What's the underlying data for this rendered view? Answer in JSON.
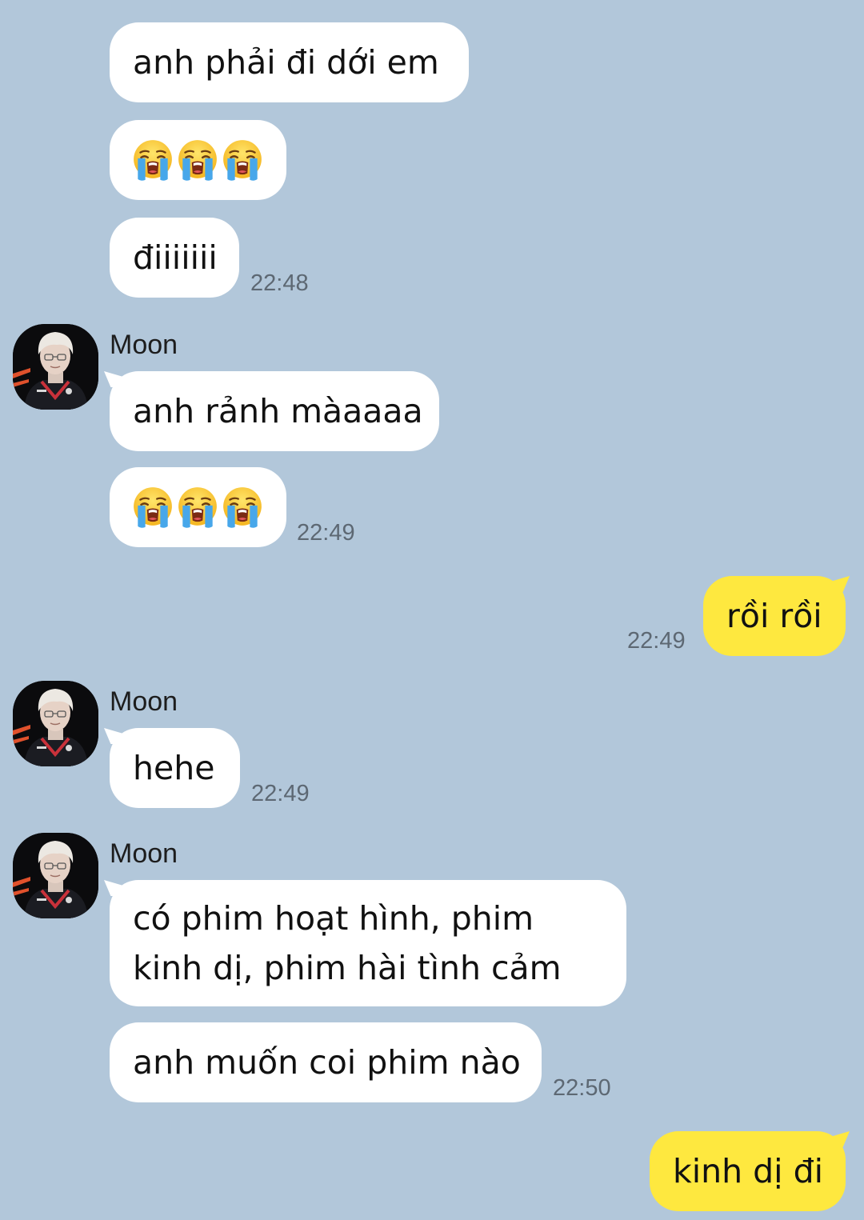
{
  "contact": {
    "name": "Moon"
  },
  "messages": {
    "m1": "anh phải đi dới em",
    "m2_emoji": "loudly-crying-face x3",
    "m3": "điiiiiii",
    "m3_time": "22:48",
    "m4": "anh rảnh màaaaa",
    "m5_emoji": "loudly-crying-face x3",
    "m5_time": "22:49",
    "m6": "rồi rồi",
    "m6_time": "22:49",
    "m7": "hehe",
    "m7_time": "22:49",
    "m8": "có phim hoạt hình, phim kinh dị, phim hài tình cảm",
    "m9": "anh muốn coi phim nào",
    "m9_time": "22:50",
    "m10": "kinh dị đi"
  },
  "colors": {
    "background": "#b2c7da",
    "incoming_bubble": "#ffffff",
    "outgoing_bubble": "#fee83f",
    "timestamp": "#5d6873"
  }
}
